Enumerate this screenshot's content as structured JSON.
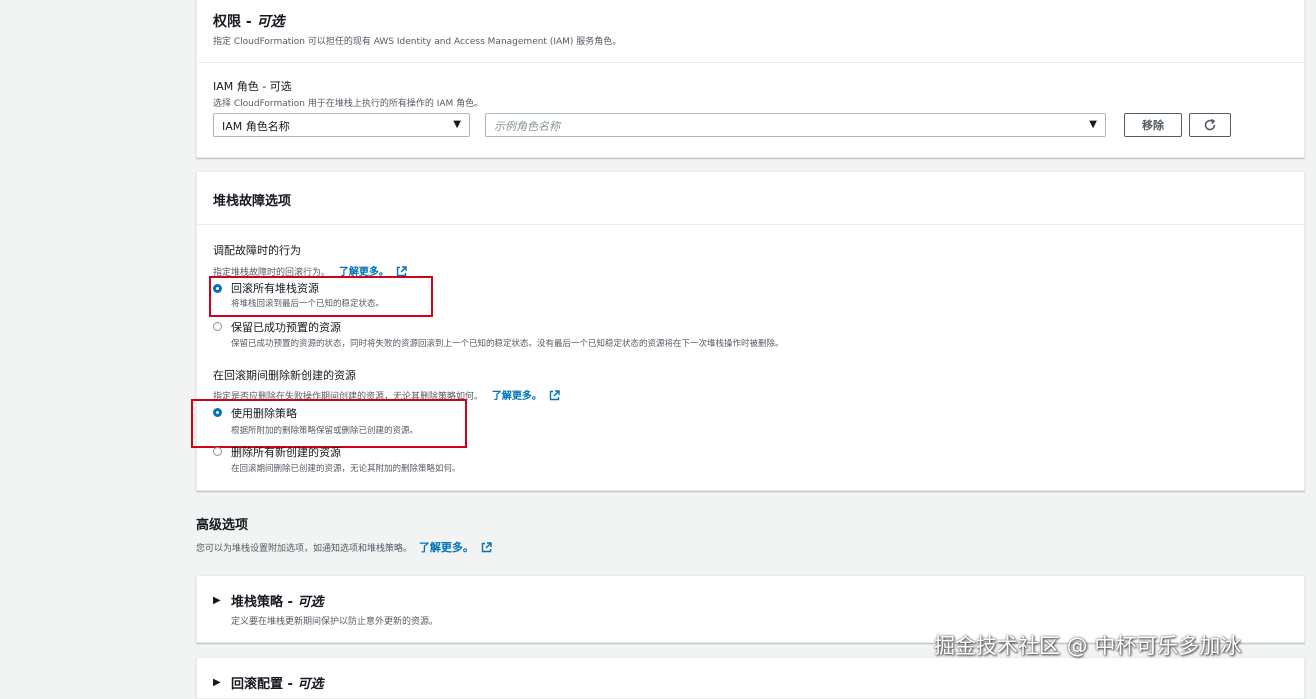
{
  "permissions": {
    "title": "权限 -",
    "title_optional": "可选",
    "description": "指定 CloudFormation 可以担任的现有 AWS Identity and Access Management (IAM) 服务角色。",
    "iam_role_label": "IAM 角色 - 可选",
    "iam_role_description": "选择 CloudFormation 用于在堆栈上执行的所有操作的 IAM 角色。",
    "role_type_select_value": "IAM 角色名称",
    "role_name_placeholder": "示例角色名称",
    "remove_button": "移除"
  },
  "failure_options": {
    "title": "堆栈故障选项",
    "provisioning_label": "调配故障时的行为",
    "provisioning_desc": "指定堆栈故障时的回滚行为。",
    "learn_more": "了解更多。",
    "rollback_all": {
      "label": "回滚所有堆栈资源",
      "desc": "将堆栈回滚到最后一个已知的稳定状态。",
      "selected": true
    },
    "preserve": {
      "label": "保留已成功预置的资源",
      "desc": "保留已成功预置的资源的状态，同时将失败的资源回滚到上一个已知的稳定状态。没有最后一个已知稳定状态的资源将在下一次堆栈操作时被删除。",
      "selected": false
    },
    "delete_label": "在回滚期间删除新创建的资源",
    "delete_desc": "指定是否应删除在失败操作期间创建的资源，无论其删除策略如何。",
    "use_deletion_policy": {
      "label": "使用删除策略",
      "desc": "根据所附加的删除策略保留或删除已创建的资源。",
      "selected": true
    },
    "delete_all_new": {
      "label": "删除所有新创建的资源",
      "desc": "在回滚期间删除已创建的资源，无论其附加的删除策略如何。",
      "selected": false
    }
  },
  "advanced": {
    "title": "高级选项",
    "description": "您可以为堆栈设置附加选项，如通知选项和堆栈策略。",
    "learn_more": "了解更多。",
    "stack_policy": {
      "title": "堆栈策略 -",
      "title_optional": "可选",
      "description": "定义要在堆栈更新期间保护以防止意外更新的资源。"
    },
    "rollback_config": {
      "title": "回滚配置 -",
      "title_optional": "可选"
    }
  },
  "watermark": "掘金技术社区 @ 中杯可乐多加冰",
  "colors": {
    "accent": "#0073bb",
    "highlight": "#d0021b",
    "page_background": "#f2f3f3"
  },
  "icons": [
    "external-link-icon",
    "refresh-icon",
    "caret-down-icon",
    "caret-right-icon"
  ]
}
